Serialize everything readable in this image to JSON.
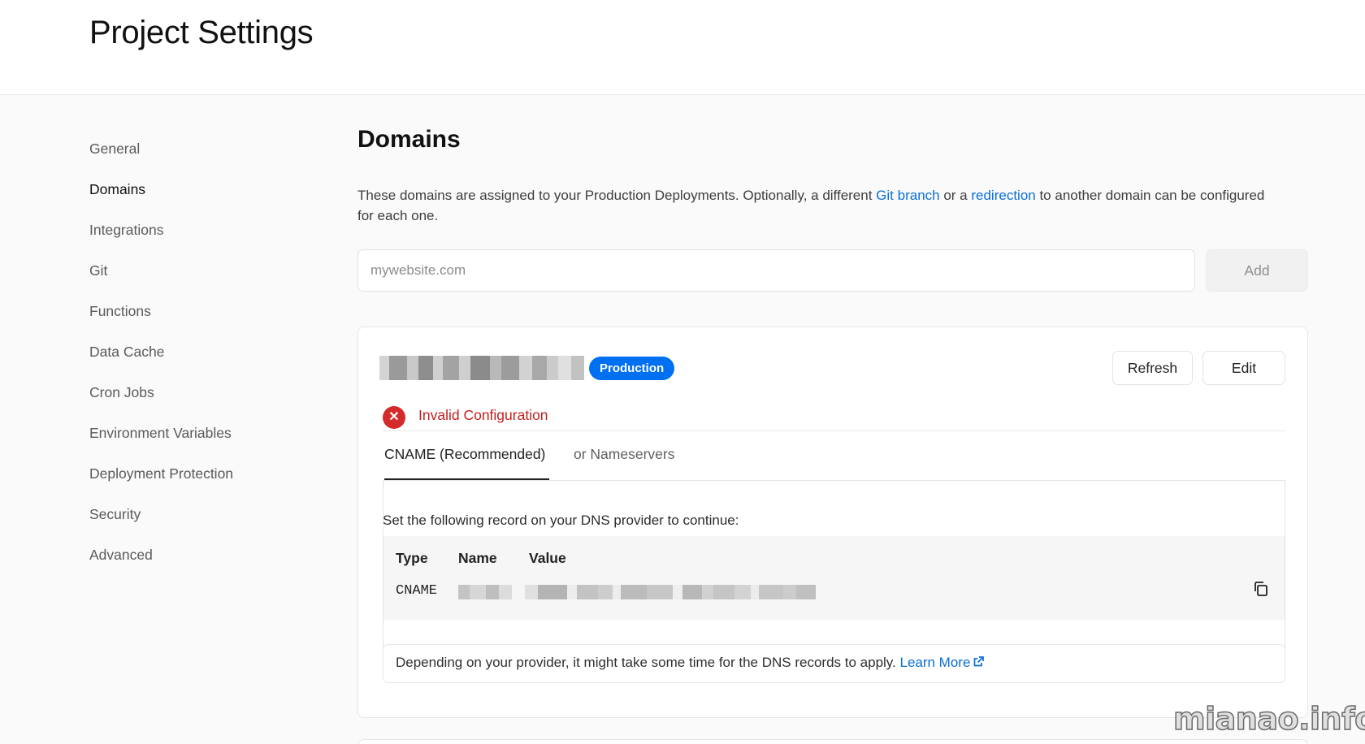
{
  "header": {
    "title": "Project Settings"
  },
  "sidebar": {
    "items": [
      {
        "label": "General"
      },
      {
        "label": "Domains",
        "active": true
      },
      {
        "label": "Integrations"
      },
      {
        "label": "Git"
      },
      {
        "label": "Functions"
      },
      {
        "label": "Data Cache"
      },
      {
        "label": "Cron Jobs"
      },
      {
        "label": "Environment Variables"
      },
      {
        "label": "Deployment Protection"
      },
      {
        "label": "Security"
      },
      {
        "label": "Advanced"
      }
    ]
  },
  "domains": {
    "title": "Domains",
    "description_part1": "These domains are assigned to your Production Deployments. Optionally, a different ",
    "git_branch_link": "Git branch",
    "description_part2": " or a ",
    "redirection_link": "redirection",
    "description_part3": " to another domain can be configured for each one.",
    "input_placeholder": "mywebsite.com",
    "input_value": "",
    "add_label": "Add"
  },
  "domain_card": {
    "domain_name_blurred": true,
    "badge": "Production",
    "refresh_label": "Refresh",
    "edit_label": "Edit",
    "error_text": "Invalid Configuration",
    "tabs": [
      {
        "label": "CNAME (Recommended)",
        "active": true
      },
      {
        "label": "or Nameservers",
        "active": false
      }
    ],
    "instruction": "Set the following record on your DNS provider to continue:",
    "record": {
      "headers": {
        "type": "Type",
        "name": "Name",
        "value": "Value"
      },
      "type_value": "CNAME",
      "name_blurred": true,
      "value_blurred": true
    },
    "note_text": "Depending on your provider, it might take some time for the DNS records to apply. ",
    "learn_more": "Learn More"
  },
  "watermark": "mianao.info",
  "colors": {
    "accent": "#0070f3",
    "link": "#0a6fd8",
    "error": "#d32a2a",
    "background": "#fafafa"
  },
  "icons": {
    "error": "x-circle-icon",
    "copy": "copy-icon",
    "external": "external-link-icon"
  }
}
